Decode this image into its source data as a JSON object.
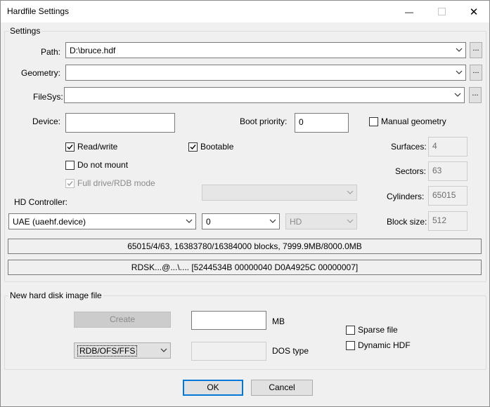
{
  "window": {
    "title": "Hardfile Settings",
    "minimize_glyph": "—",
    "close_glyph": "✕"
  },
  "settings": {
    "group_label": "Settings",
    "path_label": "Path:",
    "path_value": "D:\\bruce.hdf",
    "geometry_label": "Geometry:",
    "geometry_value": "",
    "filesys_label": "FileSys:",
    "filesys_value": "",
    "browse_label": "...",
    "device_label": "Device:",
    "device_value": "",
    "boot_priority_label": "Boot priority:",
    "boot_priority_value": "0",
    "manual_geometry_label": "Manual geometry",
    "read_write_label": "Read/write",
    "bootable_label": "Bootable",
    "do_not_mount_label": "Do not mount",
    "full_drive_label": "Full drive/RDB mode",
    "surfaces_label": "Surfaces:",
    "surfaces_value": "4",
    "sectors_label": "Sectors:",
    "sectors_value": "63",
    "cylinders_label": "Cylinders:",
    "cylinders_value": "65015",
    "block_size_label": "Block size:",
    "block_size_value": "512",
    "hd_controller_label": "HD Controller:",
    "controller_value": "UAE (uaehf.device)",
    "unit_value": "0",
    "type_value": "HD",
    "extra_value": "",
    "info_line1": "65015/4/63, 16383780/16384000 blocks, 7999.9MB/8000.0MB",
    "info_line2": "RDSK...@...\\.... [5244534B 00000040 D0A4925C 00000007]"
  },
  "new_image": {
    "group_label": "New hard disk image file",
    "create_label": "Create",
    "size_value": "",
    "size_unit": "MB",
    "dostype_combo": "RDB/OFS/FFS",
    "dostype_value": "",
    "dostype_label": "DOS type",
    "sparse_label": "Sparse file",
    "dynamic_label": "Dynamic HDF"
  },
  "footer": {
    "ok_label": "OK",
    "cancel_label": "Cancel"
  }
}
